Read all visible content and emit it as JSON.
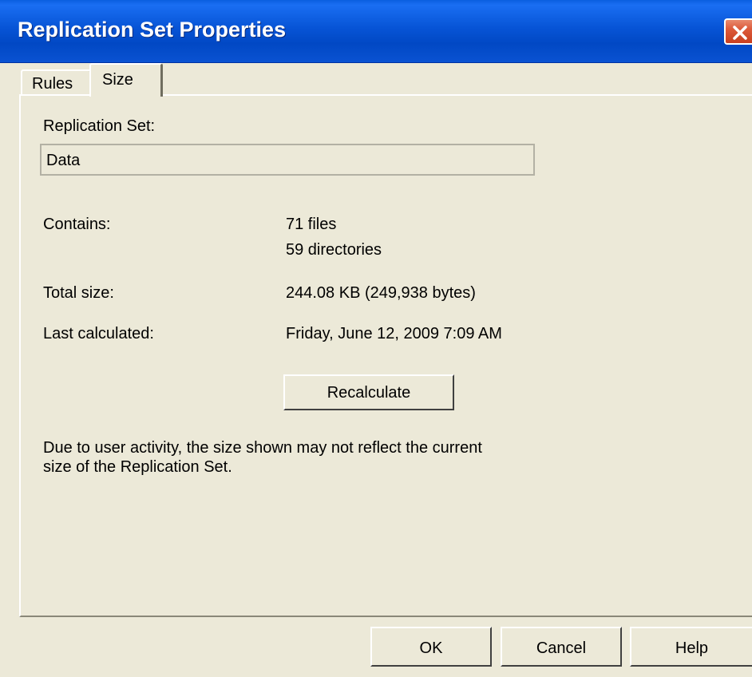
{
  "window": {
    "title": "Replication Set Properties"
  },
  "tabs": [
    {
      "label": "Rules",
      "selected": false
    },
    {
      "label": "Size",
      "selected": true
    }
  ],
  "size_tab": {
    "replication_set_label": "Replication Set:",
    "replication_set_value": "Data",
    "contains_label": "Contains:",
    "files_value": "71 files",
    "directories_value": "59 directories",
    "total_size_label": "Total size:",
    "total_size_value": "244.08 KB (249,938 bytes)",
    "last_calculated_label": "Last calculated:",
    "last_calculated_value": "Friday, June 12, 2009 7:09 AM",
    "recalculate_label": "Recalculate",
    "notice_line1": "Due to user activity, the size shown may not reflect the current",
    "notice_line2": "size of the Replication Set."
  },
  "buttons": {
    "ok": "OK",
    "cancel": "Cancel",
    "help": "Help"
  },
  "colors": {
    "titlebar": "#0754d6",
    "dialog_background": "#ece9d8",
    "close_button": "#dc5a3a"
  },
  "icons": {
    "close": "close-icon"
  }
}
